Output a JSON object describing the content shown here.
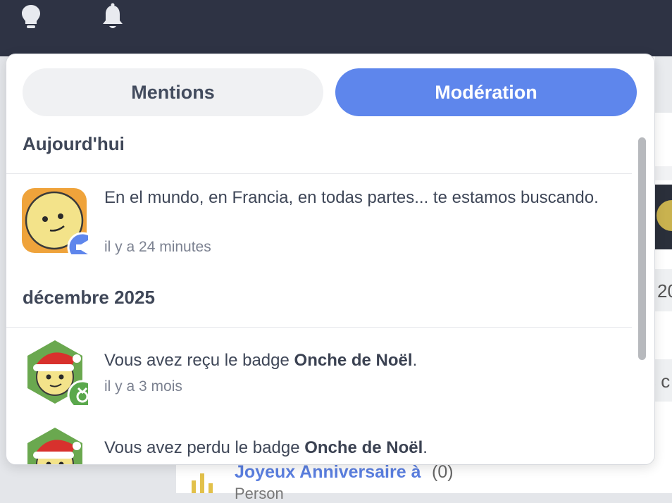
{
  "tabs": {
    "mentions_label": "Mentions",
    "moderation_label": "Modération",
    "active": "moderation"
  },
  "sections": [
    {
      "title": "Aujourd'hui",
      "notifications": [
        {
          "text": "En el mundo, en Francia, en todas partes... te estamos buscando.",
          "time": "il y a 24 minutes",
          "badge_icon": "megaphone-icon"
        }
      ]
    },
    {
      "title": "décembre 2025",
      "notifications": [
        {
          "text_prefix": "Vous avez reçu le badge ",
          "badge_name": "Onche de Noël",
          "text_suffix": ".",
          "time": "il y a 3 mois",
          "badge_icon": "medal-icon"
        },
        {
          "text_prefix": "Vous avez perdu le badge ",
          "badge_name": "Onche de Noël",
          "text_suffix": "."
        }
      ]
    }
  ],
  "background": {
    "year_fragment": "20",
    "word_fragment": "s c",
    "link_text": "Joyeux Anniversaire à",
    "link_count": "(0)",
    "sub_text": "Person"
  },
  "colors": {
    "accent": "#5e86ec",
    "topbar": "#2e3344",
    "badge_blue": "#5e86ec",
    "badge_green": "#5aa84c"
  }
}
